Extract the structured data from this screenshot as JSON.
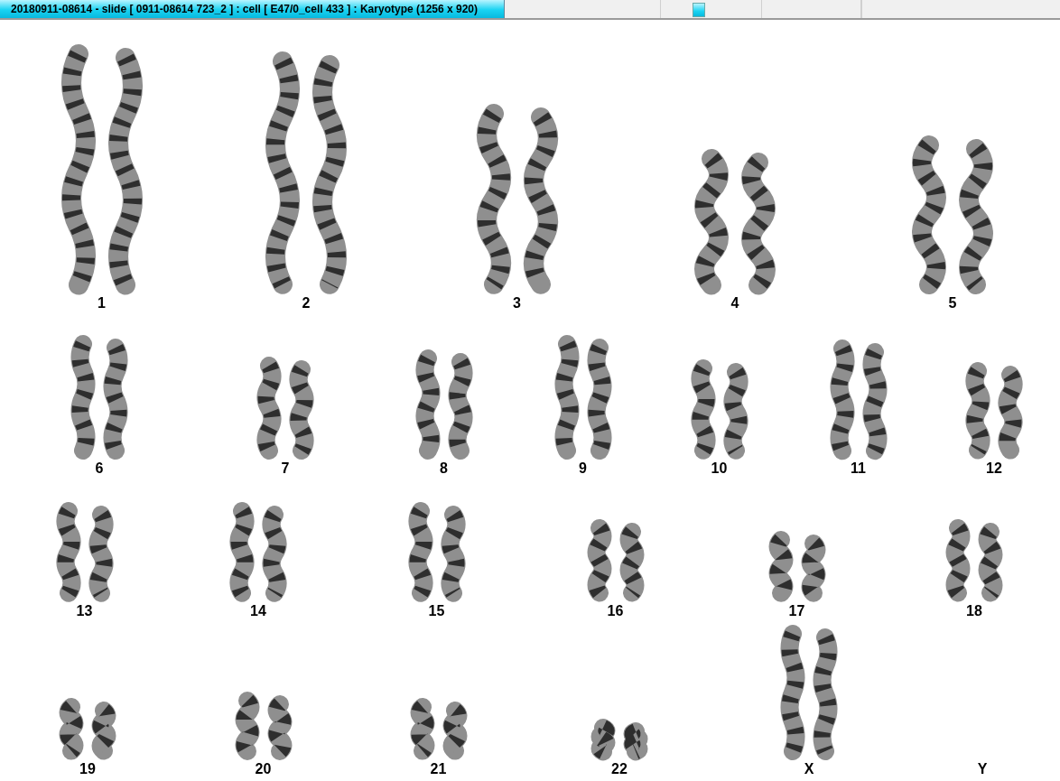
{
  "window": {
    "title": "20180911-08614 - slide [ 0911-08614 723_2 ] : cell [ E47/0_cell 433 ] : Karyotype  (1256 x 920)"
  },
  "karyotype_rows": [
    {
      "pairs": [
        {
          "label": "1",
          "empty": false
        },
        {
          "label": "2",
          "empty": false
        },
        {
          "label": "3",
          "empty": false
        },
        {
          "label": "4",
          "empty": false
        },
        {
          "label": "5",
          "empty": false
        }
      ]
    },
    {
      "pairs": [
        {
          "label": "6",
          "empty": false
        },
        {
          "label": "7",
          "empty": false
        },
        {
          "label": "8",
          "empty": false
        },
        {
          "label": "9",
          "empty": false
        },
        {
          "label": "10",
          "empty": false
        },
        {
          "label": "11",
          "empty": false
        },
        {
          "label": "12",
          "empty": false
        }
      ]
    },
    {
      "pairs": [
        {
          "label": "13",
          "empty": false
        },
        {
          "label": "14",
          "empty": false
        },
        {
          "label": "15",
          "empty": false
        },
        {
          "label": "16",
          "empty": false
        },
        {
          "label": "17",
          "empty": false
        },
        {
          "label": "18",
          "empty": false
        }
      ]
    },
    {
      "pairs": [
        {
          "label": "19",
          "empty": false
        },
        {
          "label": "20",
          "empty": false
        },
        {
          "label": "21",
          "empty": false
        },
        {
          "label": "22",
          "empty": false
        },
        {
          "label": "X",
          "empty": false
        },
        {
          "label": "Y",
          "empty": true
        }
      ]
    }
  ]
}
